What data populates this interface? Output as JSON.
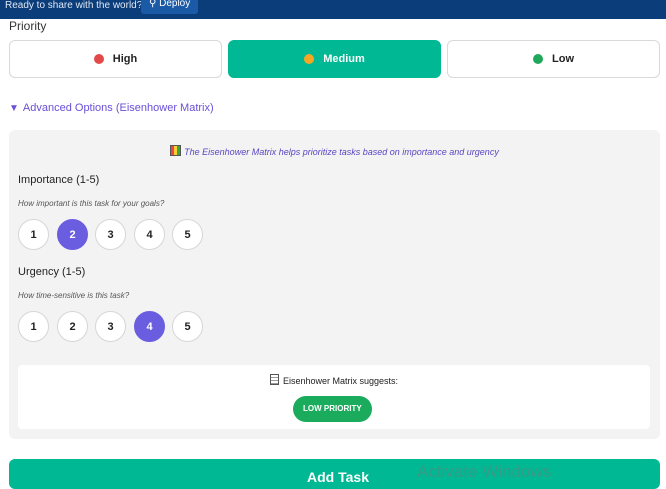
{
  "topbar": {
    "message": "Ready to share with the world?",
    "deploy_label": "Deploy",
    "deploy_icon": "rocket-icon"
  },
  "priority": {
    "label": "Priority",
    "options": [
      {
        "label": "High",
        "dot_color": "#e24a4a",
        "active": false
      },
      {
        "label": "Medium",
        "dot_color": "#f5a623",
        "active": true
      },
      {
        "label": "Low",
        "dot_color": "#20a85a",
        "active": false
      }
    ]
  },
  "advanced": {
    "toggle_label": "Advanced Options (Eisenhower Matrix)",
    "info": "The Eisenhower Matrix helps prioritize tasks based on importance and urgency",
    "importance": {
      "title": "Importance (1-5)",
      "hint": "How important is this task for your goals?",
      "options": [
        "1",
        "2",
        "3",
        "4",
        "5"
      ],
      "selected": "2"
    },
    "urgency": {
      "title": "Urgency (1-5)",
      "hint": "How time-sensitive is this task?",
      "options": [
        "1",
        "2",
        "3",
        "4",
        "5"
      ],
      "selected": "4"
    },
    "suggestion": {
      "heading": "Eisenhower Matrix suggests:",
      "badge": "LOW PRIORITY",
      "badge_color": "#1aab5c"
    }
  },
  "submit_label": "Add Task",
  "watermark": "Activate Windows",
  "colors": {
    "accent": "#00b893",
    "purple": "#6a5de0",
    "topbar": "#0b3d7a"
  }
}
